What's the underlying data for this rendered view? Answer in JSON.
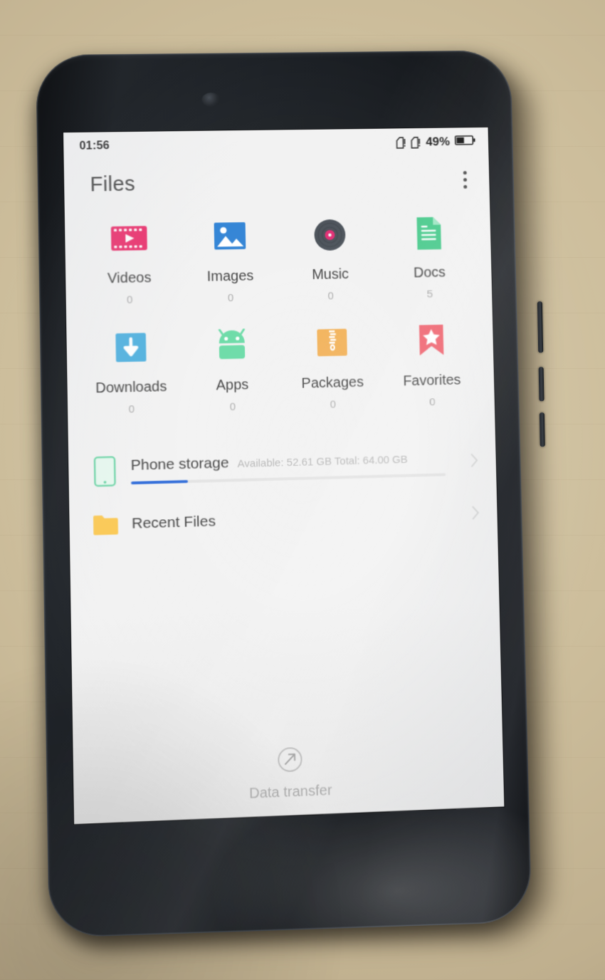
{
  "scene": {
    "description": "photo of a black smartphone lying on tan cardboard showing the Files app",
    "background_color": "#cdbe9c",
    "phone_body_color": "#1a1e23"
  },
  "status_bar": {
    "time": "01:56",
    "battery_percent": "49%",
    "battery_level": 49,
    "sim1_icon": "sim-card-missing-icon",
    "sim2_icon": "sim-card-missing-icon",
    "battery_icon": "battery-icon"
  },
  "app": {
    "title": "Files",
    "overflow_icon": "overflow-menu-icon"
  },
  "categories": [
    {
      "label": "Videos",
      "count": "0",
      "icon": "film-strip-icon",
      "color": "#ea2a68"
    },
    {
      "label": "Images",
      "count": "0",
      "icon": "photo-icon",
      "color": "#2a7fd4"
    },
    {
      "label": "Music",
      "count": "0",
      "icon": "vinyl-record-icon",
      "color": "#434a52"
    },
    {
      "label": "Docs",
      "count": "5",
      "icon": "document-icon",
      "color": "#45c98a"
    },
    {
      "label": "Downloads",
      "count": "0",
      "icon": "download-arrow-icon",
      "color": "#4aaede"
    },
    {
      "label": "Apps",
      "count": "0",
      "icon": "android-robot-icon",
      "color": "#63d9a2"
    },
    {
      "label": "Packages",
      "count": "0",
      "icon": "zip-archive-icon",
      "color": "#f2ad4e"
    },
    {
      "label": "Favorites",
      "count": "0",
      "icon": "bookmark-star-icon",
      "color": "#ef5f6b"
    }
  ],
  "storage_row": {
    "title": "Phone storage",
    "subtitle": "Available: 52.61 GB Total: 64.00 GB",
    "available_gb": 52.61,
    "total_gb": 64.0,
    "used_percent": 17.8,
    "icon": "phone-storage-icon",
    "chevron_icon": "chevron-right-icon",
    "bar_color": "#2a68d8"
  },
  "recent_row": {
    "title": "Recent Files",
    "icon": "folder-icon",
    "chevron_icon": "chevron-right-icon"
  },
  "bottom_action": {
    "label": "Data transfer",
    "icon": "data-transfer-icon"
  }
}
